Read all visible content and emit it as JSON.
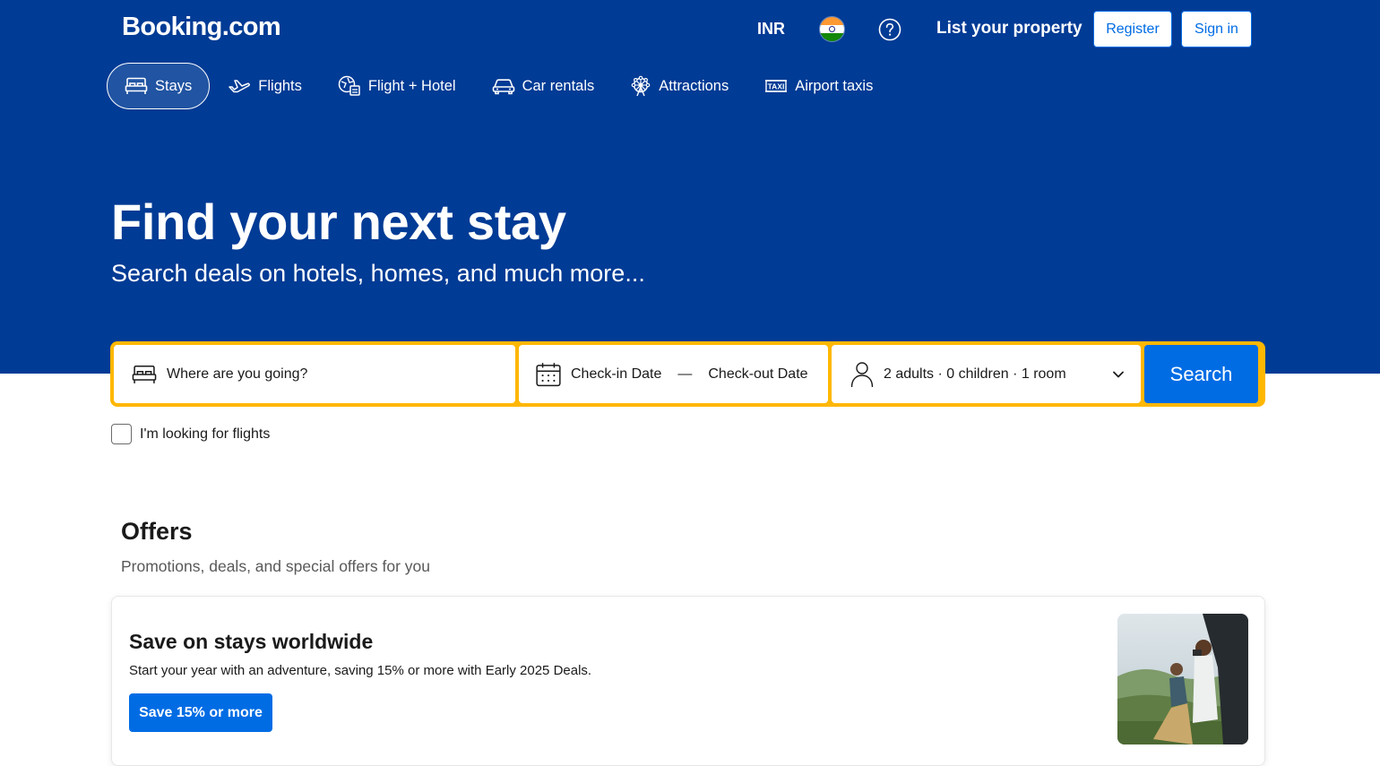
{
  "header": {
    "logo": "Booking.com",
    "currency": "INR",
    "flag_icon": "india-flag-icon",
    "help_icon": "question-circle-icon",
    "list_property": "List your property",
    "register": "Register",
    "sign_in": "Sign in"
  },
  "nav": {
    "items": [
      {
        "label": "Stays",
        "icon": "bed-icon",
        "active": true
      },
      {
        "label": "Flights",
        "icon": "airplane-icon",
        "active": false
      },
      {
        "label": "Flight + Hotel",
        "icon": "flight-hotel-icon",
        "active": false
      },
      {
        "label": "Car rentals",
        "icon": "car-icon",
        "active": false
      },
      {
        "label": "Attractions",
        "icon": "ferris-wheel-icon",
        "active": false
      },
      {
        "label": "Airport taxis",
        "icon": "taxi-icon",
        "active": false
      }
    ]
  },
  "hero": {
    "title": "Find your next stay",
    "subtitle": "Search deals on hotels, homes, and much more..."
  },
  "search": {
    "destination_placeholder": "Where are you going?",
    "checkin": "Check-in Date",
    "dash": "—",
    "checkout": "Check-out Date",
    "guests": "2 adults · 0 children · 1 room",
    "button": "Search",
    "flights_checkbox_label": "I'm looking for flights",
    "flights_checked": false
  },
  "offers": {
    "title": "Offers",
    "subtitle": "Promotions, deals, and special offers for you",
    "card": {
      "title": "Save on stays worldwide",
      "description": "Start your year with an adventure, saving 15% or more with Early 2025 Deals.",
      "button": "Save 15% or more"
    }
  },
  "colors": {
    "brand_blue": "#003b95",
    "action_blue": "#006ce4",
    "search_border": "#ffb700"
  }
}
